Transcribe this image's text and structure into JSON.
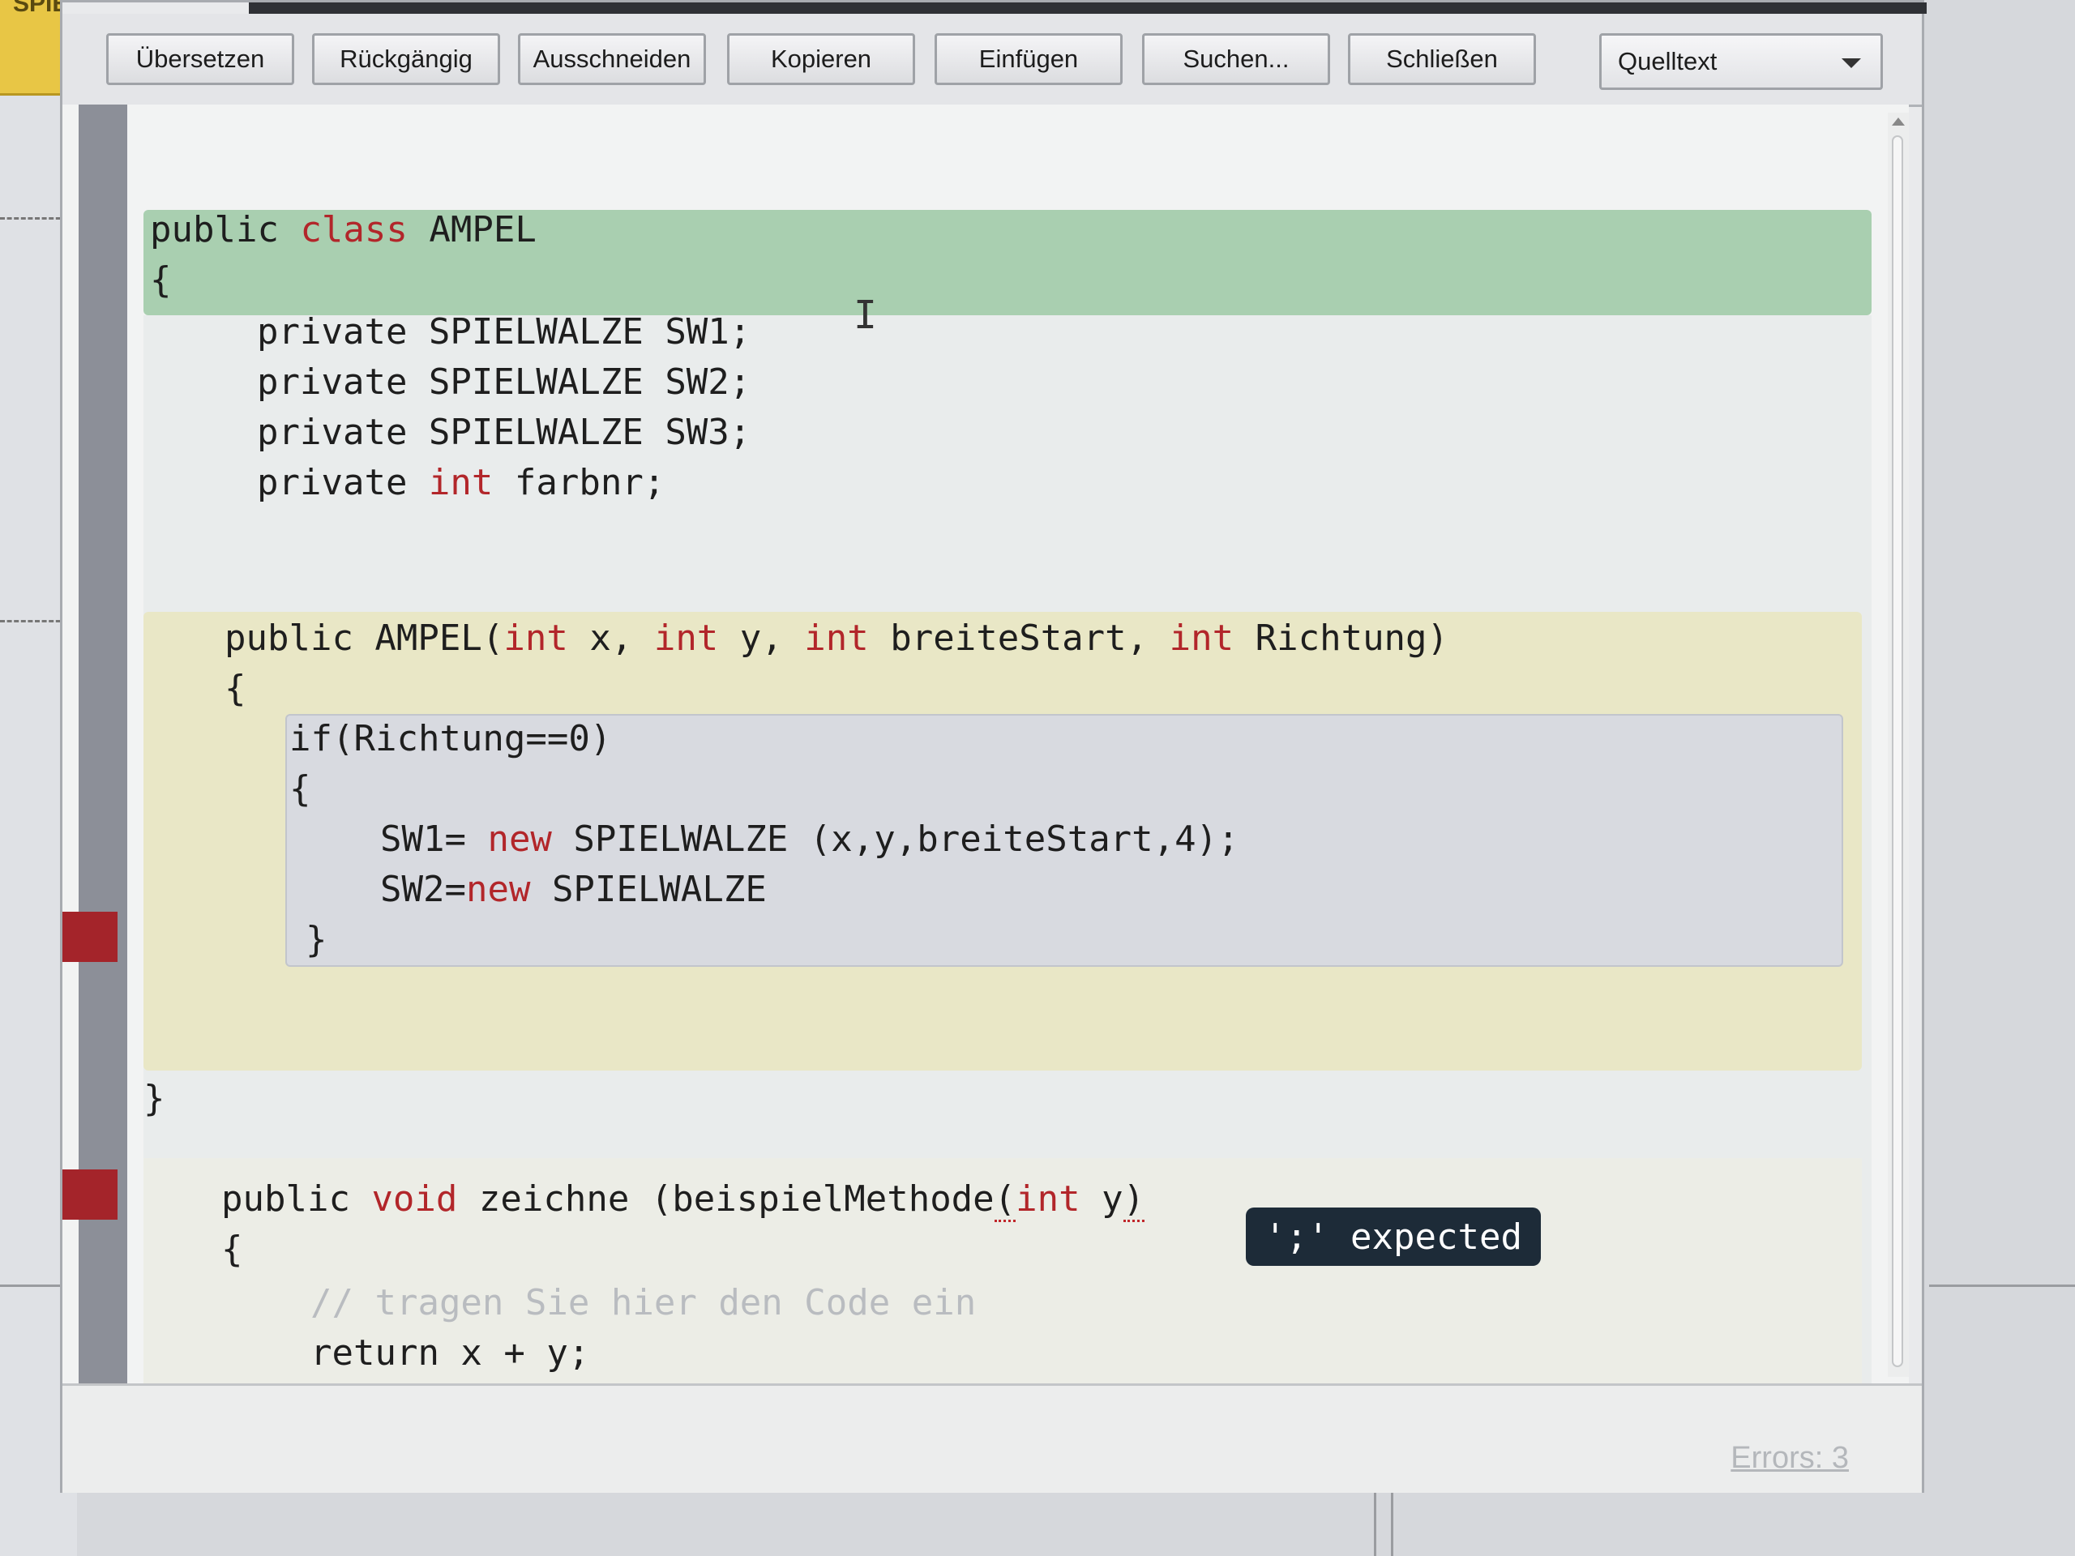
{
  "background": {
    "tab_label": "SPIE"
  },
  "toolbar": {
    "buttons": [
      "Übersetzen",
      "Rückgängig",
      "Ausschneiden",
      "Kopieren",
      "Einfügen",
      "Suchen...",
      "Schließen"
    ],
    "view_select": "Quelltext"
  },
  "editor": {
    "lines": {
      "l1_a": "public ",
      "l1_kw": "class",
      "l1_b": " AMPEL",
      "l2": "{",
      "l3": "private SPIELWALZE SW1;",
      "l4": "private SPIELWALZE SW2;",
      "l5": "private SPIELWALZE SW3;",
      "l6_a": "private ",
      "l6_kw": "int",
      "l6_b": " farbnr;",
      "l7_a": "public AMPEL(",
      "l7_kw1": "int",
      "l7_b": " x, ",
      "l7_kw2": "int",
      "l7_c": " y, ",
      "l7_kw3": "int",
      "l7_d": " breiteStart, ",
      "l7_kw4": "int",
      "l7_e": " Richtung)",
      "l8": "{",
      "l9": "if(Richtung==0)",
      "l10": "{",
      "l11_a": "SW1= ",
      "l11_kw": "new",
      "l11_b": " SPIELWALZE (x,y,breiteStart,4);",
      "l12_a": "SW2=",
      "l12_kw": "new",
      "l12_b": " SPIELWALZE",
      "l13": "}",
      "l14": "}",
      "l15_a": "public ",
      "l15_kw": "void",
      "l15_b": " zeichne (beispielMethode",
      "l15_err1": "(",
      "l15_kw2": "int",
      "l15_c": " y",
      "l15_err2": ")",
      "l16": "{",
      "l17": "// tragen Sie hier den Code ein",
      "l18": "return x + y;"
    },
    "tooltip": "';' expected"
  },
  "status": {
    "errors": "Errors: 3"
  },
  "colors": {
    "keyword": "#b2262a",
    "class_scope": "#a9cfb0",
    "constructor_scope": "#e9e7c6",
    "error_marker": "#a4242a"
  }
}
